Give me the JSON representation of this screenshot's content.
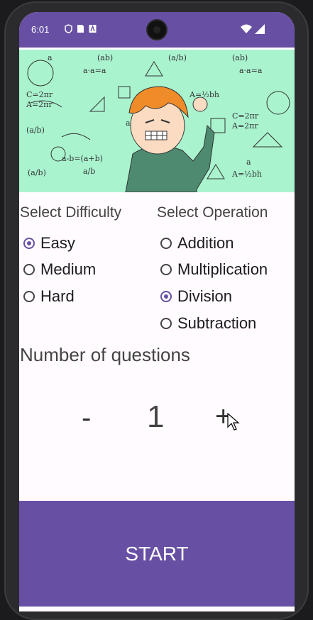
{
  "status": {
    "time": "6:01"
  },
  "banner": {
    "alt": "math formulas cartoon boy"
  },
  "difficulty": {
    "label": "Select Difficulty",
    "options": [
      {
        "label": "Easy",
        "checked": true
      },
      {
        "label": "Medium",
        "checked": false
      },
      {
        "label": "Hard",
        "checked": false
      }
    ]
  },
  "operation": {
    "label": "Select Operation",
    "options": [
      {
        "label": "Addition",
        "checked": false
      },
      {
        "label": "Multiplication",
        "checked": false
      },
      {
        "label": "Division",
        "checked": true
      },
      {
        "label": "Subtraction",
        "checked": false
      }
    ]
  },
  "questions": {
    "label": "Number of questions",
    "minus": "-",
    "count": "1",
    "plus": "+"
  },
  "start_label": "START",
  "colors": {
    "primary": "#6750a4",
    "banner_bg": "#a9f3cf"
  }
}
